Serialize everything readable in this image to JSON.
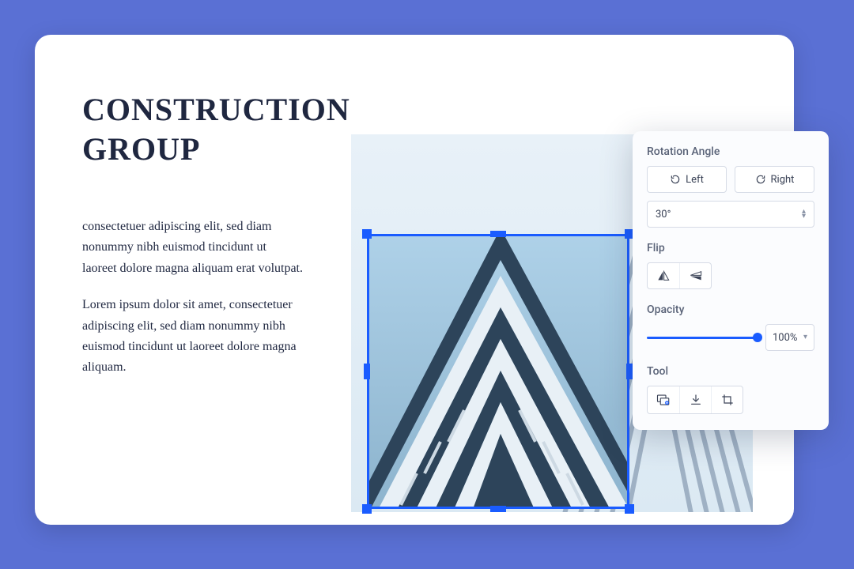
{
  "document": {
    "title": "CONSTRUCTION GROUP",
    "para1": "consectetuer adipiscing elit, sed diam nonummy nibh euismod tincidunt ut laoreet dolore magna aliquam erat volutpat.",
    "para2": "Lorem ipsum dolor sit amet, consectetuer adipiscing elit, sed diam nonummy nibh euismod tincidunt ut laoreet dolore magna aliquam."
  },
  "panel": {
    "rotation": {
      "label": "Rotation Angle",
      "left_label": "Left",
      "right_label": "Right",
      "angle_value": "30°"
    },
    "flip": {
      "label": "Flip"
    },
    "opacity": {
      "label": "Opacity",
      "value": "100%"
    },
    "tool": {
      "label": "Tool"
    }
  }
}
